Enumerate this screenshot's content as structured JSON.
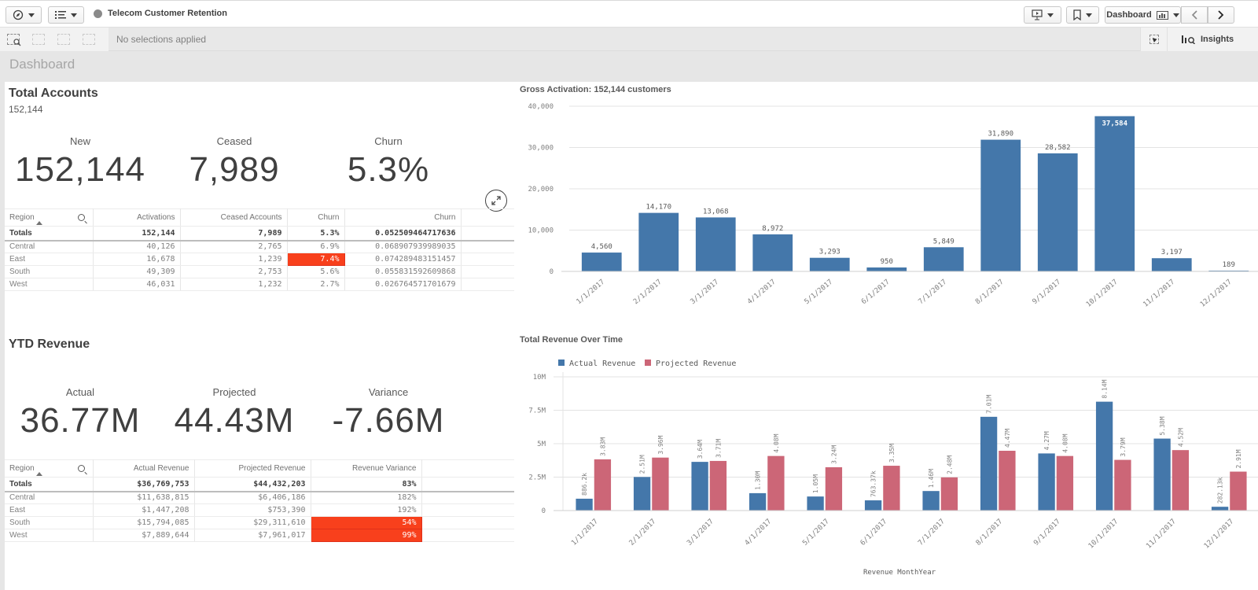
{
  "toolbar": {
    "nav_icon": "compass-icon",
    "list_icon": "list-icon",
    "app_title": "Telecom Customer Retention",
    "present_icon": "presentation-icon",
    "bookmark_icon": "bookmark-icon",
    "sheet_selector_label": "Dashboard",
    "prev_icon": "chevron-left-icon",
    "next_icon": "chevron-right-icon"
  },
  "selection_bar": {
    "status": "No selections applied",
    "insights_label": "Insights"
  },
  "sheet": {
    "title": "Dashboard"
  },
  "accounts": {
    "title": "Total Accounts",
    "subtitle": "152,144",
    "kpis": [
      {
        "label": "New",
        "value": "152,144"
      },
      {
        "label": "Ceased",
        "value": "7,989"
      },
      {
        "label": "Churn",
        "value": "5.3%"
      }
    ],
    "table": {
      "headers": [
        "Region",
        "Activations",
        "Ceased Accounts",
        "Churn",
        "Churn"
      ],
      "totals": [
        "Totals",
        "152,144",
        "7,989",
        "5.3%",
        "0.052509464717636"
      ],
      "rows": [
        [
          "Central",
          "40,126",
          "2,765",
          "6.9%",
          "0.068907939989035"
        ],
        [
          "East",
          "16,678",
          "1,239",
          "7.4%",
          "0.074289483151457"
        ],
        [
          "South",
          "49,309",
          "2,753",
          "5.6%",
          "0.055831592609868"
        ],
        [
          "West",
          "46,031",
          "1,232",
          "2.7%",
          "0.026764571701679"
        ]
      ],
      "highlight_color": "#f8401c"
    }
  },
  "revenue": {
    "title": "YTD Revenue",
    "kpis": [
      {
        "label": "Actual",
        "value": "36.77M"
      },
      {
        "label": "Projected",
        "value": "44.43M"
      },
      {
        "label": "Variance",
        "value": "-7.66M"
      }
    ],
    "table": {
      "headers": [
        "Region",
        "Actual Revenue",
        "Projected Revenue",
        "Revenue Variance"
      ],
      "totals": [
        "Totals",
        "$36,769,753",
        "$44,432,203",
        "83%"
      ],
      "rows": [
        [
          "Central",
          "$11,638,815",
          "$6,406,186",
          "182%"
        ],
        [
          "East",
          "$1,447,208",
          "$753,390",
          "192%"
        ],
        [
          "South",
          "$15,794,085",
          "$29,311,610",
          "54%"
        ],
        [
          "West",
          "$7,889,644",
          "$7,961,017",
          "99%"
        ]
      ]
    }
  },
  "chart_data": [
    {
      "type": "bar",
      "title": "Gross Activation: 152,144 customers",
      "categories": [
        "1/1/2017",
        "2/1/2017",
        "3/1/2017",
        "4/1/2017",
        "5/1/2017",
        "6/1/2017",
        "7/1/2017",
        "8/1/2017",
        "9/1/2017",
        "10/1/2017",
        "11/1/2017",
        "12/1/2017"
      ],
      "values": [
        4560,
        14170,
        13068,
        8972,
        3293,
        950,
        5849,
        31890,
        28582,
        37584,
        3197,
        189
      ],
      "value_labels": [
        "4,560",
        "14,170",
        "13,068",
        "8,972",
        "3,293",
        "950",
        "5,849",
        "31,890",
        "28,582",
        "37,584",
        "3,197",
        "189"
      ],
      "yticks": [
        0,
        10000,
        20000,
        30000,
        40000
      ],
      "ytick_labels": [
        "0",
        "10,000",
        "20,000",
        "30,000",
        "40,000"
      ],
      "ylim": [
        0,
        40000
      ],
      "xlabel": "",
      "ylabel": "",
      "grid": true,
      "color": "#4477aa"
    },
    {
      "type": "bar",
      "title": "Total Revenue Over Time",
      "categories": [
        "1/1/2017",
        "2/1/2017",
        "3/1/2017",
        "4/1/2017",
        "5/1/2017",
        "6/1/2017",
        "7/1/2017",
        "8/1/2017",
        "9/1/2017",
        "10/1/2017",
        "11/1/2017",
        "12/1/2017"
      ],
      "series": [
        {
          "name": "Actual Revenue",
          "color": "#4477aa",
          "values": [
            886200,
            2510000,
            3640000,
            1300000,
            1050000,
            763370,
            1460000,
            7010000,
            4270000,
            8140000,
            5380000,
            282130
          ],
          "labels": [
            "886.2k",
            "2.51M",
            "3.64M",
            "1.30M",
            "1.05M",
            "763.37k",
            "1.46M",
            "7.01M",
            "4.27M",
            "8.14M",
            "5.38M",
            "282.13k"
          ]
        },
        {
          "name": "Projected Revenue",
          "color": "#cc6677",
          "values": [
            3830000,
            3960000,
            3710000,
            4080000,
            3240000,
            3350000,
            2480000,
            4470000,
            4080000,
            3790000,
            4520000,
            2910000
          ],
          "labels": [
            "3.83M",
            "3.96M",
            "3.71M",
            "4.08M",
            "3.24M",
            "3.35M",
            "2.48M",
            "4.47M",
            "4.08M",
            "3.79M",
            "4.52M",
            "2.91M"
          ]
        }
      ],
      "yticks": [
        0,
        2500000,
        5000000,
        7500000,
        10000000
      ],
      "ytick_labels": [
        "0",
        "2.5M",
        "5M",
        "7.5M",
        "10M"
      ],
      "ylim": [
        0,
        10000000
      ],
      "xlabel": "Revenue MonthYear",
      "ylabel": "",
      "legend": "top-left",
      "grid": true
    }
  ]
}
